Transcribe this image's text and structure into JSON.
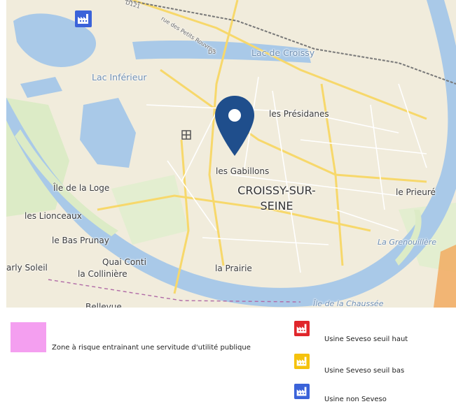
{
  "map": {
    "labels": {
      "lac_croissy": "Lac de Croissy",
      "lac_inferieur": "Lac Inférieur",
      "presidanes": "les Présidanes",
      "gabillons": "les Gabillons",
      "city_line1": "CROISSY-SUR-",
      "city_line2": "SEINE",
      "ile_loge": "Île de la Loge",
      "prieure": "le Prieuré",
      "lionceaux": "les Lionceaux",
      "bas_prunay": "le Bas Prunay",
      "grenouillere": "La Grenouillère",
      "quai_conti": "Quai Conti",
      "marly_soleil": "arly Soleil",
      "colliniere": "la Collinière",
      "prairie": "la Prairie",
      "ile_chaussee": "Île de la Chaussée",
      "bellevue": "Bellevue",
      "road_d121": "D121",
      "road_petits_rouvres": "rue des Petits Rouvres",
      "road_d3": "D3"
    },
    "pin_color": "#1f4e8c",
    "river_color": "#a9c9e8",
    "land_color": "#f1ecdc"
  },
  "factory_icon": {
    "name": "factory-icon",
    "color": "#3b63d9"
  },
  "legend": {
    "zone_label": "Zone à risque entrainant une servitude d'utilité publique",
    "zone_color": "#f49ff0",
    "items": [
      {
        "label": "Usine Seveso seuil haut",
        "color": "#e0262b"
      },
      {
        "label": "Usine Seveso seuil bas",
        "color": "#f5c20d"
      },
      {
        "label": "Usine non Seveso",
        "color": "#3b63d9"
      }
    ]
  }
}
